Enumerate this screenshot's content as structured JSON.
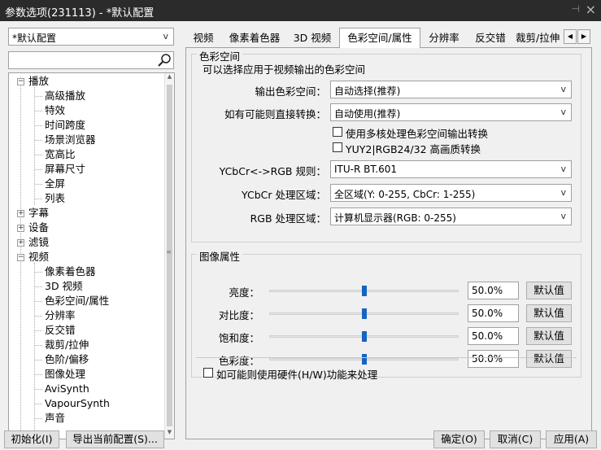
{
  "window": {
    "title": "参数选项(231113) - *默认配置",
    "pin_glyph": "⊣",
    "close_glyph": "×"
  },
  "profile": {
    "selected": "*默认配置"
  },
  "search": {
    "value": ""
  },
  "tree": {
    "items": [
      {
        "label": "播放",
        "expander": "−"
      },
      {
        "label": "高级播放"
      },
      {
        "label": "特效"
      },
      {
        "label": "时间跨度"
      },
      {
        "label": "场景浏览器"
      },
      {
        "label": "宽高比"
      },
      {
        "label": "屏幕尺寸"
      },
      {
        "label": "全屏"
      },
      {
        "label": "列表"
      },
      {
        "label": "字幕",
        "expander": "+"
      },
      {
        "label": "设备",
        "expander": "+"
      },
      {
        "label": "滤镜",
        "expander": "+"
      },
      {
        "label": "视频",
        "expander": "−"
      },
      {
        "label": "像素着色器"
      },
      {
        "label": "3D 视频"
      },
      {
        "label": "色彩空间/属性"
      },
      {
        "label": "分辨率"
      },
      {
        "label": "反交错"
      },
      {
        "label": "裁剪/拉伸"
      },
      {
        "label": "色阶/偏移"
      },
      {
        "label": "图像处理"
      },
      {
        "label": "AviSynth"
      },
      {
        "label": "VapourSynth"
      },
      {
        "label": "声音"
      }
    ]
  },
  "tabs": [
    "视频",
    "像素着色器",
    "3D 视频",
    "色彩空间/属性",
    "分辨率",
    "反交错",
    "裁剪/拉伸"
  ],
  "colorspace": {
    "group_title": "色彩空间",
    "description": "可以选择应用于视频输出的色彩空间",
    "output_label": "输出色彩空间：",
    "output_value": "自动选择(推荐)",
    "direct_label": "如有可能则直接转换：",
    "direct_value": "自动使用(推荐)",
    "multicore_label": "使用多核处理色彩空间输出转换",
    "multicore_checked": false,
    "yuy2_label": "YUY2|RGB24/32 高画质转换",
    "yuy2_checked": false,
    "rule_label": "YCbCr<->RGB 规则：",
    "rule_value": "ITU-R BT.601",
    "ycbcr_range_label": "YCbCr 处理区域：",
    "ycbcr_range_value": "全区域(Y: 0-255, CbCr: 1-255)",
    "rgb_range_label": "RGB 处理区域：",
    "rgb_range_value": "计算机显示器(RGB: 0-255)"
  },
  "image": {
    "group_title": "图像属性",
    "default_label": "默认值",
    "rows": [
      {
        "label": "亮度：",
        "value": "50.0%",
        "level": 0.5
      },
      {
        "label": "对比度：",
        "value": "50.0%",
        "level": 0.5
      },
      {
        "label": "饱和度：",
        "value": "50.0%",
        "level": 0.5
      },
      {
        "label": "色彩度：",
        "value": "50.0%",
        "level": 0.5
      }
    ],
    "hw_label": "如可能则使用硬件(H/W)功能来处理",
    "hw_checked": false
  },
  "footer": {
    "init": "初始化(I)",
    "export": "导出当前配置(S)...",
    "ok": "确定(O)",
    "cancel": "取消(C)",
    "apply": "应用(A)"
  },
  "colors": {
    "accent": "#1565c0",
    "titlebar": "#2b2b2b"
  }
}
